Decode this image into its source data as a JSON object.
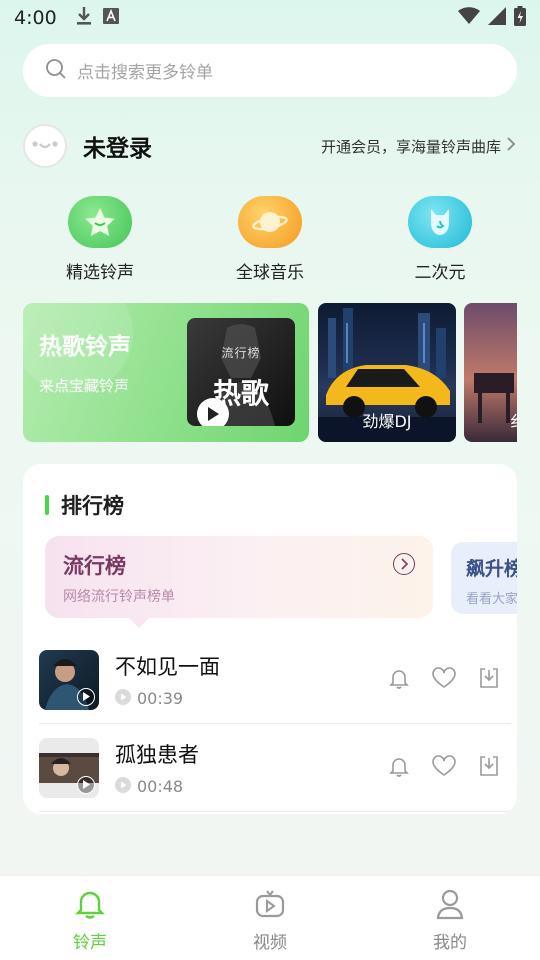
{
  "status": {
    "time": "4:00"
  },
  "search": {
    "placeholder": "点击搜索更多铃单"
  },
  "user": {
    "name": "未登录",
    "vip_text": "开通会员，享海量铃声曲库"
  },
  "categories": [
    {
      "label": "精选铃声",
      "icon": "star-icon",
      "color": "#5fd17a"
    },
    {
      "label": "全球音乐",
      "icon": "planet-icon",
      "color": "#f4a52b"
    },
    {
      "label": "二次元",
      "icon": "cat-icon",
      "color": "#2fc7dd"
    }
  ],
  "banners": {
    "main": {
      "title": "热歌铃声",
      "subtitle": "来点宝藏铃声",
      "cover_tag": "流行榜",
      "cover_text": "热歌"
    },
    "second": {
      "label": "劲爆DJ"
    },
    "third": {
      "label": "纟"
    }
  },
  "rank": {
    "title": "排行榜",
    "tabs": [
      {
        "title": "流行榜",
        "subtitle": "网络流行铃声榜单"
      },
      {
        "title": "飙升榜",
        "subtitle": "看看大家"
      }
    ],
    "songs": [
      {
        "name": "不如见一面",
        "duration": "00:39"
      },
      {
        "name": "孤独患者",
        "duration": "00:48"
      }
    ]
  },
  "tabbar": [
    {
      "label": "铃声",
      "active": true
    },
    {
      "label": "视频",
      "active": false
    },
    {
      "label": "我的",
      "active": false
    }
  ],
  "colors": {
    "accent": "#5fd13a",
    "rank_bar": "#4cd44c"
  }
}
